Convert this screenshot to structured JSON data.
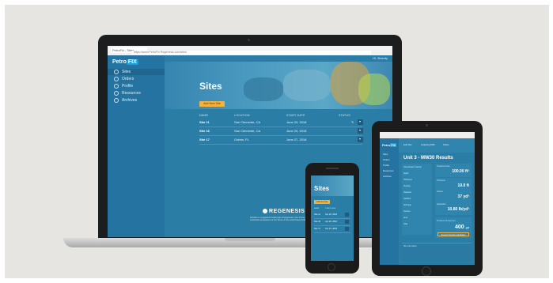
{
  "laptop": {
    "browser": {
      "tab_title": "PetroFix - Sites",
      "url": "https://www.PetroFix.Regenesis.com/sites"
    },
    "app": {
      "logo_text": "Petro",
      "logo_badge": "FIX",
      "user_label": "Hi, Brandy",
      "sidebar": {
        "items": [
          {
            "label": "Sites"
          },
          {
            "label": "Orders"
          },
          {
            "label": "Profile"
          },
          {
            "label": "Resources"
          },
          {
            "label": "Archives"
          }
        ]
      },
      "page_title": "Sites",
      "add_button": "Add New Site",
      "table": {
        "headers": [
          "NAME",
          "LOCATION",
          "START DATE",
          "STATUS"
        ],
        "rows": [
          {
            "name": "Site 11",
            "location": "San Clemente, CA",
            "date": "June 20, 2018"
          },
          {
            "name": "Site 16",
            "location": "San Clemente, CA",
            "date": "June 20, 2018"
          },
          {
            "name": "Site 17",
            "location": "Goleta, FL",
            "date": "June 27, 2018"
          }
        ]
      },
      "brand": "REGENESIS",
      "copyright": "PetroFix is a registered trademark of Regenesis. Use of this site constitutes acceptance of our Terms of Use and Privacy Policy."
    }
  },
  "tablet": {
    "logo_text": "Petro",
    "logo_badge": "FIX",
    "sidebar": [
      "Sites",
      "Orders",
      "Profile",
      "Resources",
      "Archives"
    ],
    "nav": [
      "Edit Site",
      "Graphing PDF",
      "Share"
    ],
    "title": "Unit 3 - MW30 Results",
    "left_labels": [
      "Groundwater Velocity",
      "Depth",
      "Thickness",
      "Porosity",
      "Hydraulic",
      "Gradient",
      "Soil Type",
      "Fraction",
      "Area",
      "Total"
    ],
    "cards": [
      {
        "label": "Treatment Area",
        "value": "100.00 ft²"
      },
      {
        "label": "Thickness",
        "value": "10.0 ft"
      },
      {
        "label": "Volume",
        "value": "37 yd³"
      },
      {
        "label": "Application",
        "value": "10.80 lb/yd³"
      }
    ],
    "highlight": {
      "title": "Product Required",
      "value": "400",
      "unit": "gal",
      "button": "Request Injection Application"
    },
    "footer_label": "Site Information"
  },
  "phone": {
    "title": "Sites",
    "add_button": "Add New Site",
    "headers": [
      "NAME",
      "START DATE"
    ],
    "rows": [
      {
        "name": "Site 11",
        "date": "Jun 20, 2018"
      },
      {
        "name": "Site 16",
        "date": "Jun 20, 2018"
      },
      {
        "name": "Site 17",
        "date": "Jun 27, 2018"
      }
    ]
  },
  "colors": {
    "background": "#e6e5e1",
    "app_blue": "#2a7ea6",
    "sidebar_blue": "#2473a0",
    "accent_yellow": "#f4b13d",
    "device_black": "#1c1d1f"
  }
}
